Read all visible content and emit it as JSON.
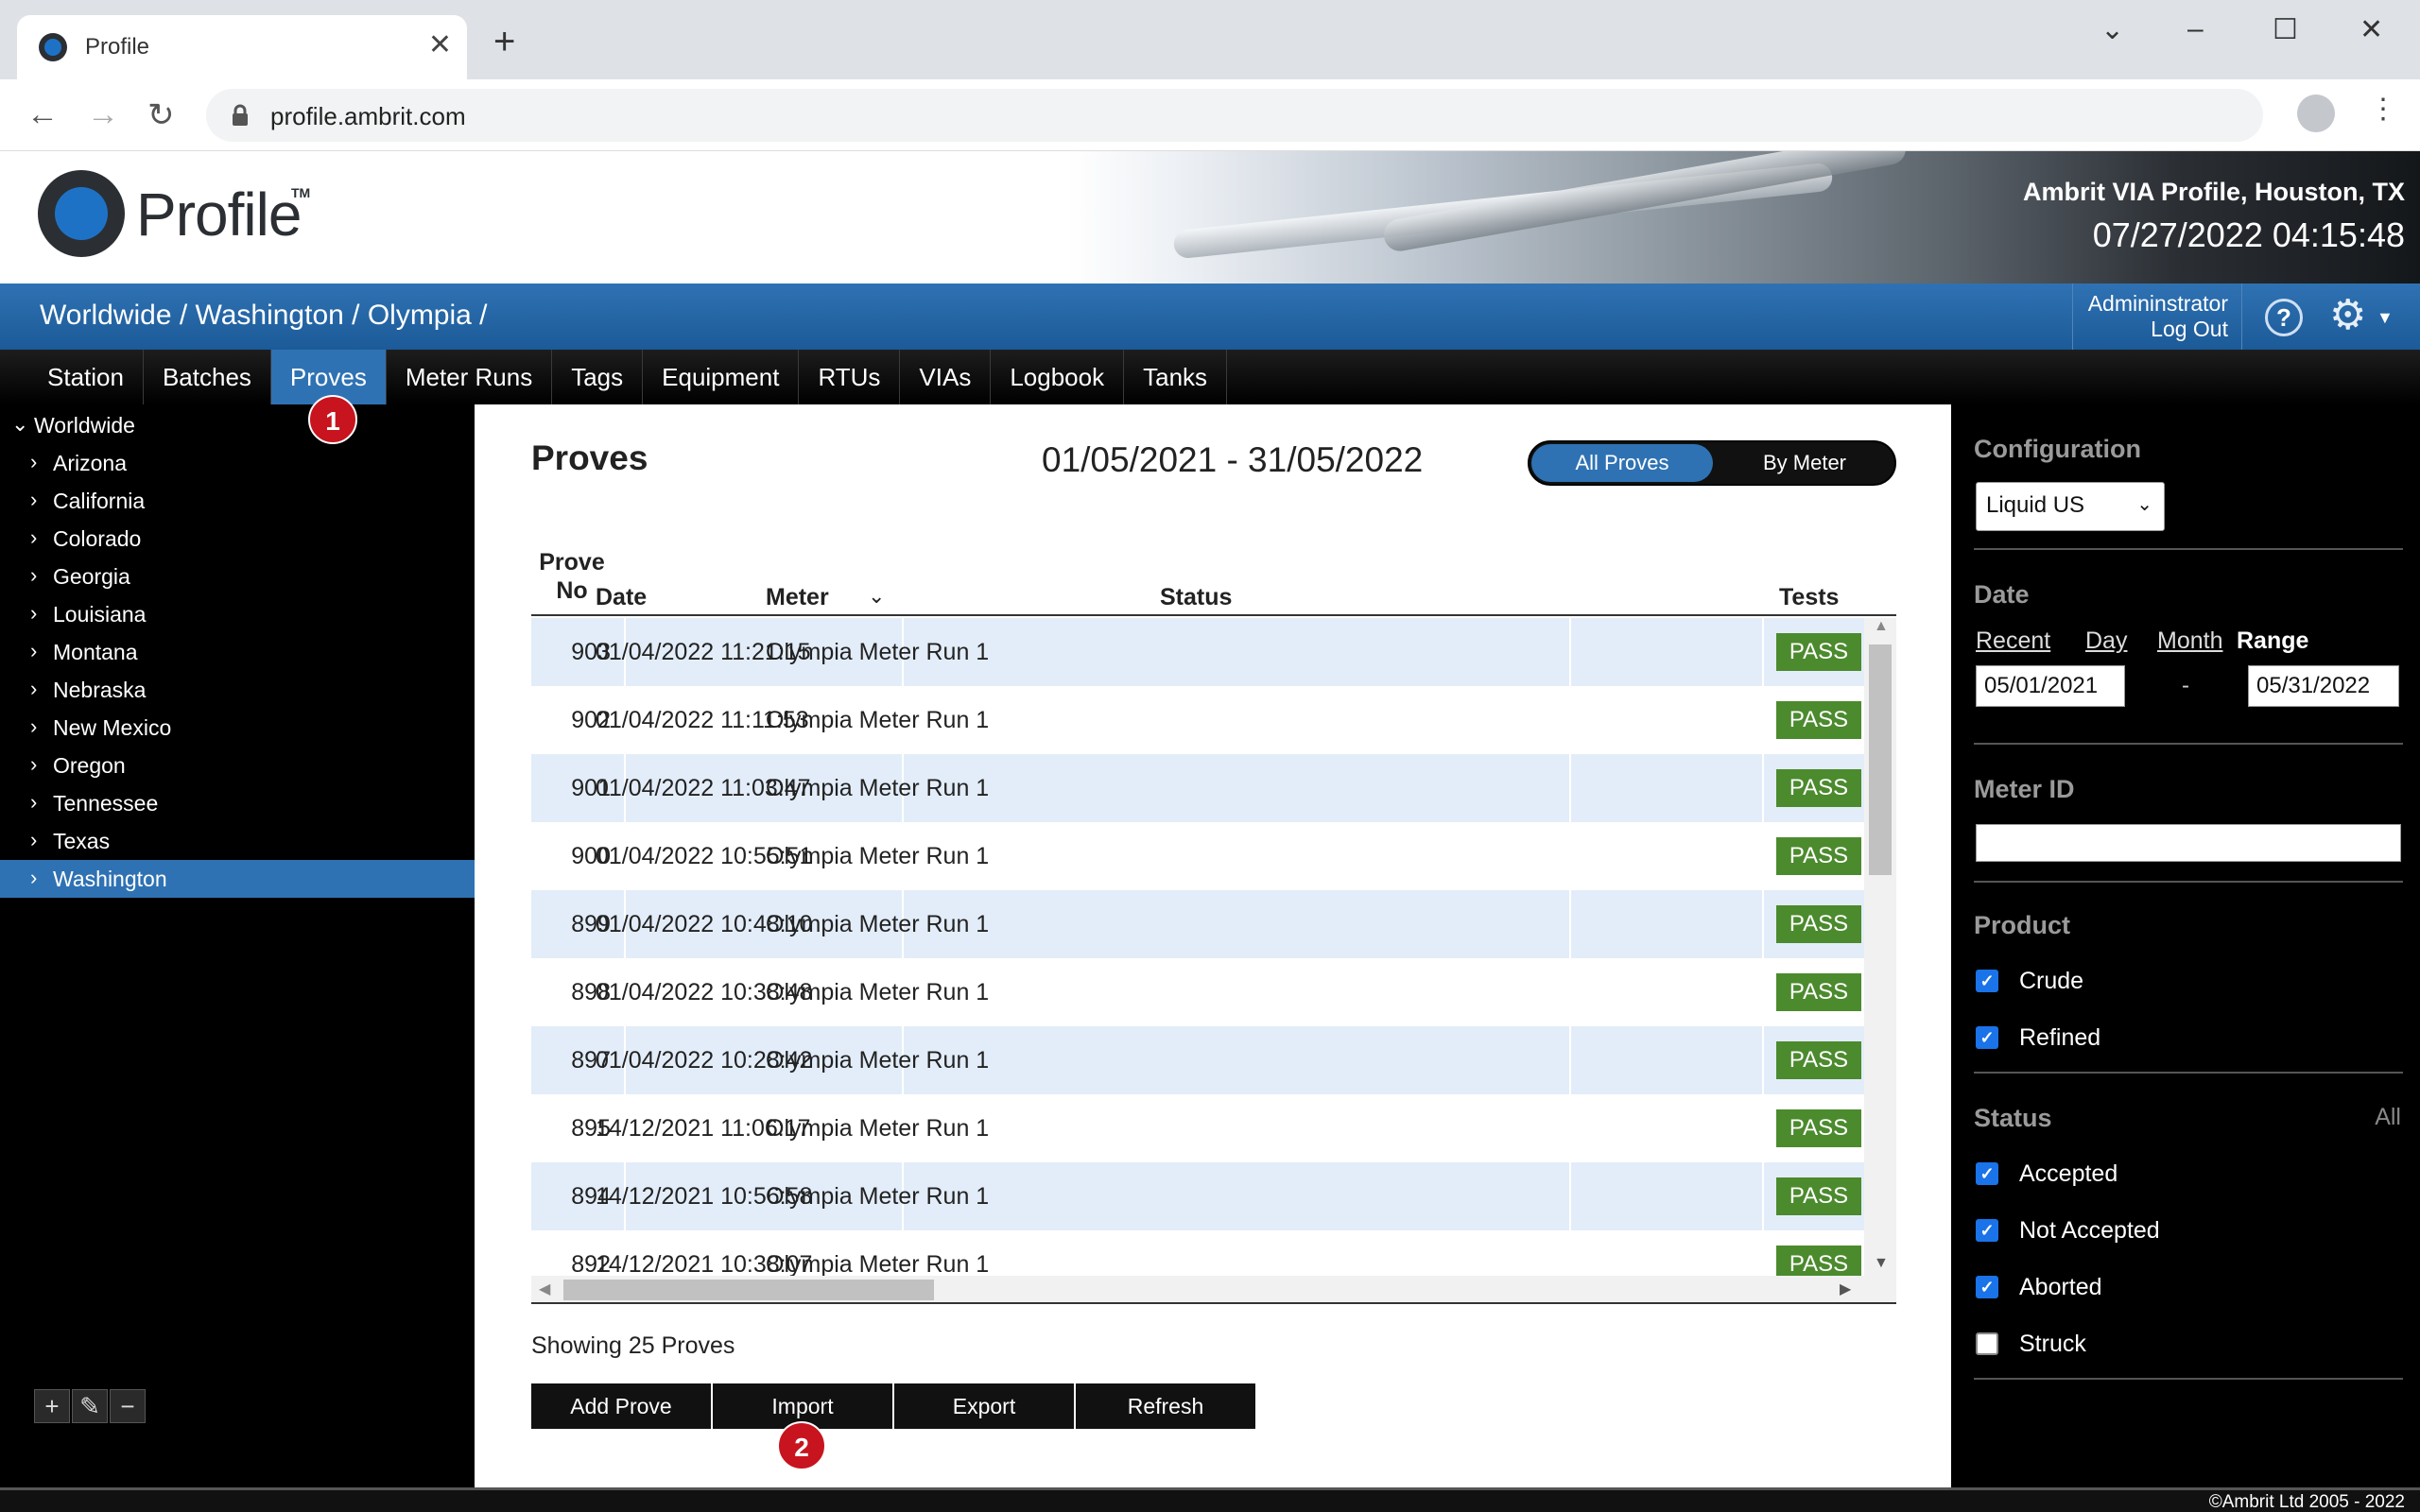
{
  "browser": {
    "tab_title": "Profile",
    "url": "profile.ambrit.com"
  },
  "header": {
    "logo_text": "Profile",
    "logo_tm": "TM",
    "company": "Ambrit VIA Profile, Houston, TX",
    "clock": "07/27/2022 04:15:48"
  },
  "breadcrumb": "Worldwide / Washington / Olympia /",
  "user": {
    "name": "Admininstrator",
    "logout": "Log Out",
    "help": "?"
  },
  "nav_tabs": [
    "Station",
    "Batches",
    "Proves",
    "Meter Runs",
    "Tags",
    "Equipment",
    "RTUs",
    "VIAs",
    "Logbook",
    "Tanks"
  ],
  "active_tab": "Proves",
  "tree": {
    "root": "Worldwide",
    "items": [
      "Arizona",
      "California",
      "Colorado",
      "Georgia",
      "Louisiana",
      "Montana",
      "Nebraska",
      "New Mexico",
      "Oregon",
      "Tennessee",
      "Texas",
      "Washington"
    ],
    "selected": "Washington"
  },
  "main": {
    "title": "Proves",
    "date_range": "01/05/2021 - 31/05/2022",
    "toggle": {
      "on": "All Proves",
      "off": "By Meter"
    },
    "columns": {
      "prove_no_1": "Prove",
      "prove_no_2": "No",
      "date": "Date",
      "meter": "Meter",
      "status": "Status",
      "tests": "Tests"
    },
    "rows": [
      {
        "no": "903",
        "date": "01/04/2022 11:21:15",
        "meter": "Olympia Meter Run 1",
        "status": "",
        "test": "PASS"
      },
      {
        "no": "902",
        "date": "01/04/2022 11:11:53",
        "meter": "Olympia Meter Run 1",
        "status": "",
        "test": "PASS"
      },
      {
        "no": "901",
        "date": "01/04/2022 11:03:47",
        "meter": "Olympia Meter Run 1",
        "status": "",
        "test": "PASS"
      },
      {
        "no": "900",
        "date": "01/04/2022 10:55:51",
        "meter": "Olympia Meter Run 1",
        "status": "",
        "test": "PASS"
      },
      {
        "no": "899",
        "date": "01/04/2022 10:48:10",
        "meter": "Olympia Meter Run 1",
        "status": "",
        "test": "PASS"
      },
      {
        "no": "898",
        "date": "01/04/2022 10:38:48",
        "meter": "Olympia Meter Run 1",
        "status": "",
        "test": "PASS"
      },
      {
        "no": "897",
        "date": "01/04/2022 10:28:42",
        "meter": "Olympia Meter Run 1",
        "status": "",
        "test": "PASS"
      },
      {
        "no": "895",
        "date": "14/12/2021 11:06:17",
        "meter": "Olympia Meter Run 1",
        "status": "",
        "test": "PASS"
      },
      {
        "no": "894",
        "date": "14/12/2021 10:56:58",
        "meter": "Olympia Meter Run 1",
        "status": "",
        "test": "PASS"
      },
      {
        "no": "892",
        "date": "14/12/2021 10:38:07",
        "meter": "Olympia Meter Run 1",
        "status": "",
        "test": "PASS"
      }
    ],
    "showing": "Showing 25 Proves",
    "buttons": [
      "Add Prove",
      "Import",
      "Export",
      "Refresh"
    ]
  },
  "callouts": [
    "1",
    "2"
  ],
  "filters": {
    "configuration": {
      "label": "Configuration",
      "value": "Liquid US"
    },
    "date": {
      "label": "Date",
      "modes": [
        "Recent",
        "Day",
        "Month",
        "Range"
      ],
      "active_mode": "Range",
      "from": "05/01/2021",
      "to": "05/31/2022",
      "dash": "-"
    },
    "meter_id": {
      "label": "Meter ID",
      "value": ""
    },
    "product": {
      "label": "Product",
      "options": [
        {
          "label": "Crude",
          "checked": true
        },
        {
          "label": "Refined",
          "checked": true
        }
      ]
    },
    "status": {
      "label": "Status",
      "all_link": "All",
      "options": [
        {
          "label": "Accepted",
          "checked": true
        },
        {
          "label": "Not Accepted",
          "checked": true
        },
        {
          "label": "Aborted",
          "checked": true
        },
        {
          "label": "Struck",
          "checked": false
        }
      ]
    }
  },
  "footer": "©Ambrit Ltd 2005 - 2022",
  "colors": {
    "accent": "#2f72b3",
    "pass": "#4c8a2e",
    "row_alt": "#e3edf9",
    "callout": "#c8141e"
  },
  "icons": {
    "favicon": "profile-logo-icon",
    "tab_close": "close-icon",
    "new_tab": "plus-icon",
    "back": "back-arrow-icon",
    "forward": "forward-arrow-icon",
    "reload": "reload-icon",
    "lock": "lock-icon",
    "account": "account-icon",
    "menu": "kebab-menu-icon",
    "help": "help-icon",
    "settings": "gear-icon",
    "tree_chevron": "chevron-right-icon",
    "add": "plus-icon",
    "edit": "pencil-icon",
    "remove": "minus-icon"
  }
}
